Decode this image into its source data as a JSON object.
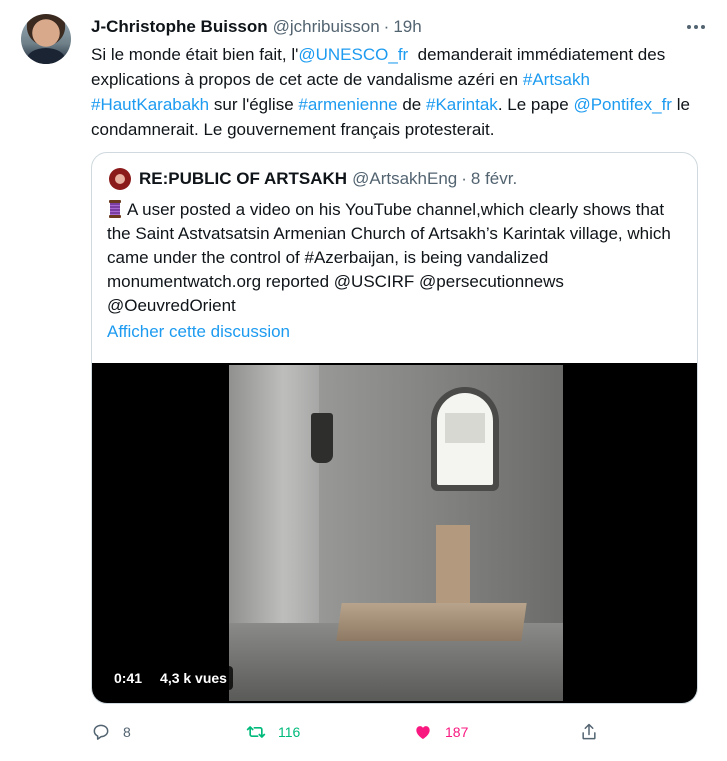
{
  "author": {
    "name": "J-Christophe Buisson",
    "handle": "@jchribuisson",
    "separator": "·",
    "time": "19h"
  },
  "tweet_text": {
    "part1": "Si le monde était bien fait, l'",
    "mention_unesco": "@UNESCO_fr",
    "part2": "  demanderait immédiatement des explications à propos de cet acte de vandalisme azéri en ",
    "hashtag_artsakh": "#Artsakh",
    "hashtag_hautkarabakh": "#HautKarabakh",
    "part3": " sur l'église ",
    "hashtag_armenienne": "#armenienne",
    "part4": " de ",
    "hashtag_karintak": "#Karintak",
    "part5": ". Le pape ",
    "mention_pontifex": "@Pontifex_fr",
    "part6": " le condamnerait. Le gouvernement français protesterait."
  },
  "quoted": {
    "name": "RE:PUBLIC OF ARTSAKH",
    "handle": "@ArtsakhEng",
    "separator": "·",
    "time": "8 févr.",
    "text": "A user posted a video on his YouTube channel,which clearly shows that the Saint Astvatsatsin Armenian Church of Artsakh’s Karintak village, which came under the control of #Azerbaijan, is being vandalized monumentwatch.org reported @USCIRF @persecutionnews @OeuvredOrient",
    "show_thread": "Afficher cette discussion",
    "video": {
      "duration": "0:41",
      "views": "4,3 k vues"
    }
  },
  "actions": {
    "replies": "8",
    "retweets": "116",
    "likes": "187"
  },
  "colors": {
    "link": "#1d9bf0",
    "retweet": "#00ba7c",
    "like": "#f91880",
    "muted": "#536471"
  },
  "icons": [
    "more-icon",
    "thread-emoji-icon",
    "reply-icon",
    "retweet-icon",
    "like-icon",
    "share-icon"
  ]
}
